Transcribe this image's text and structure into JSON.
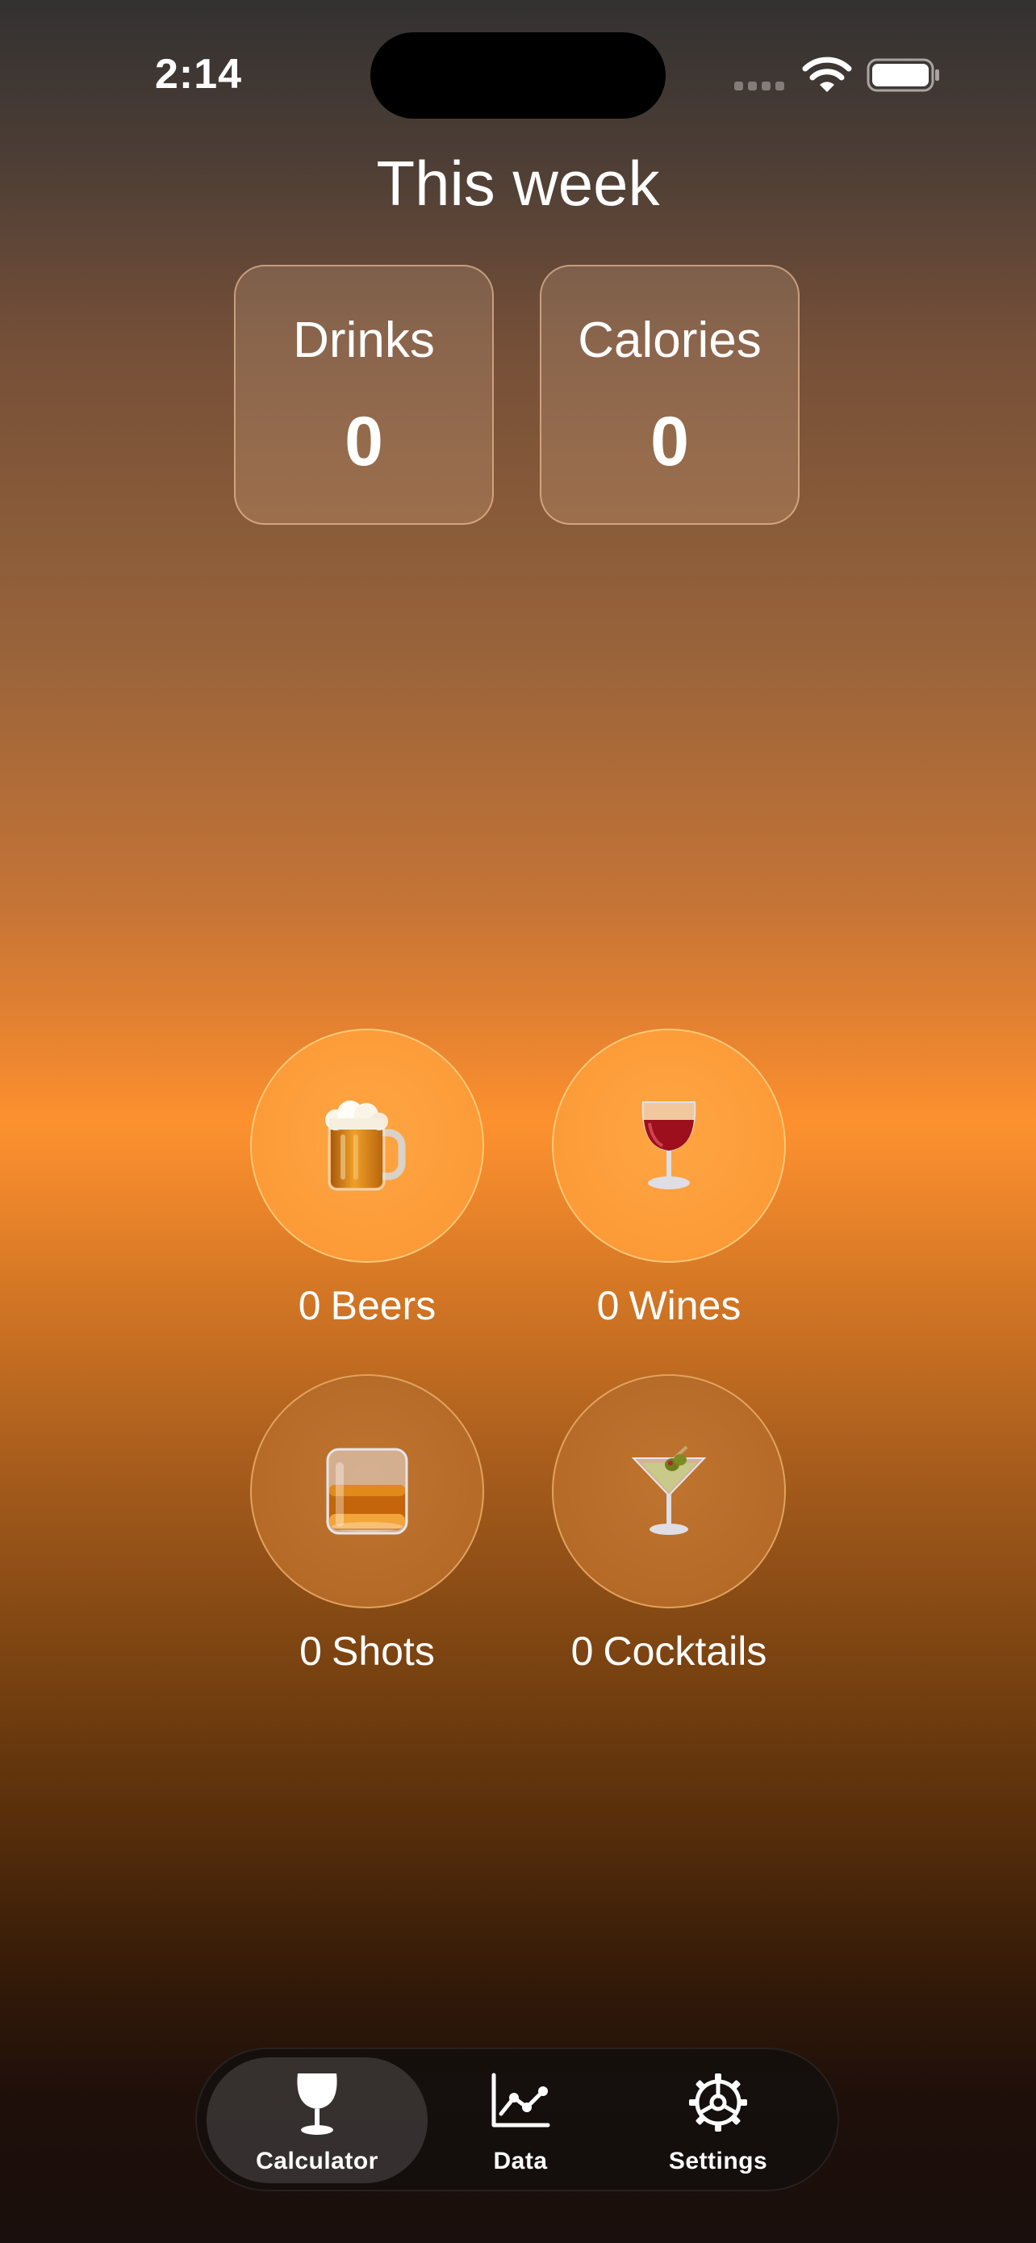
{
  "status_bar": {
    "time": "2:14"
  },
  "header": {
    "title": "This week"
  },
  "stats": {
    "drinks": {
      "label": "Drinks",
      "value": "0"
    },
    "calories": {
      "label": "Calories",
      "value": "0"
    }
  },
  "drinks": {
    "beer": {
      "icon": "beer-mug-icon",
      "count": "0",
      "label": "Beers"
    },
    "wine": {
      "icon": "wine-glass-icon",
      "count": "0",
      "label": "Wines"
    },
    "shot": {
      "icon": "tumbler-glass-icon",
      "count": "0",
      "label": "Shots"
    },
    "cocktail": {
      "icon": "cocktail-glass-icon",
      "count": "0",
      "label": "Cocktails"
    }
  },
  "tab_bar": {
    "items": [
      {
        "label": "Calculator",
        "icon": "wine-glass-icon",
        "active": true
      },
      {
        "label": "Data",
        "icon": "line-chart-icon",
        "active": false
      },
      {
        "label": "Settings",
        "icon": "gear-icon",
        "active": false
      }
    ]
  },
  "colors": {
    "accent_orange": "#fd912e",
    "top_background": "#333131",
    "bottom_background": "#1a0f0c"
  }
}
